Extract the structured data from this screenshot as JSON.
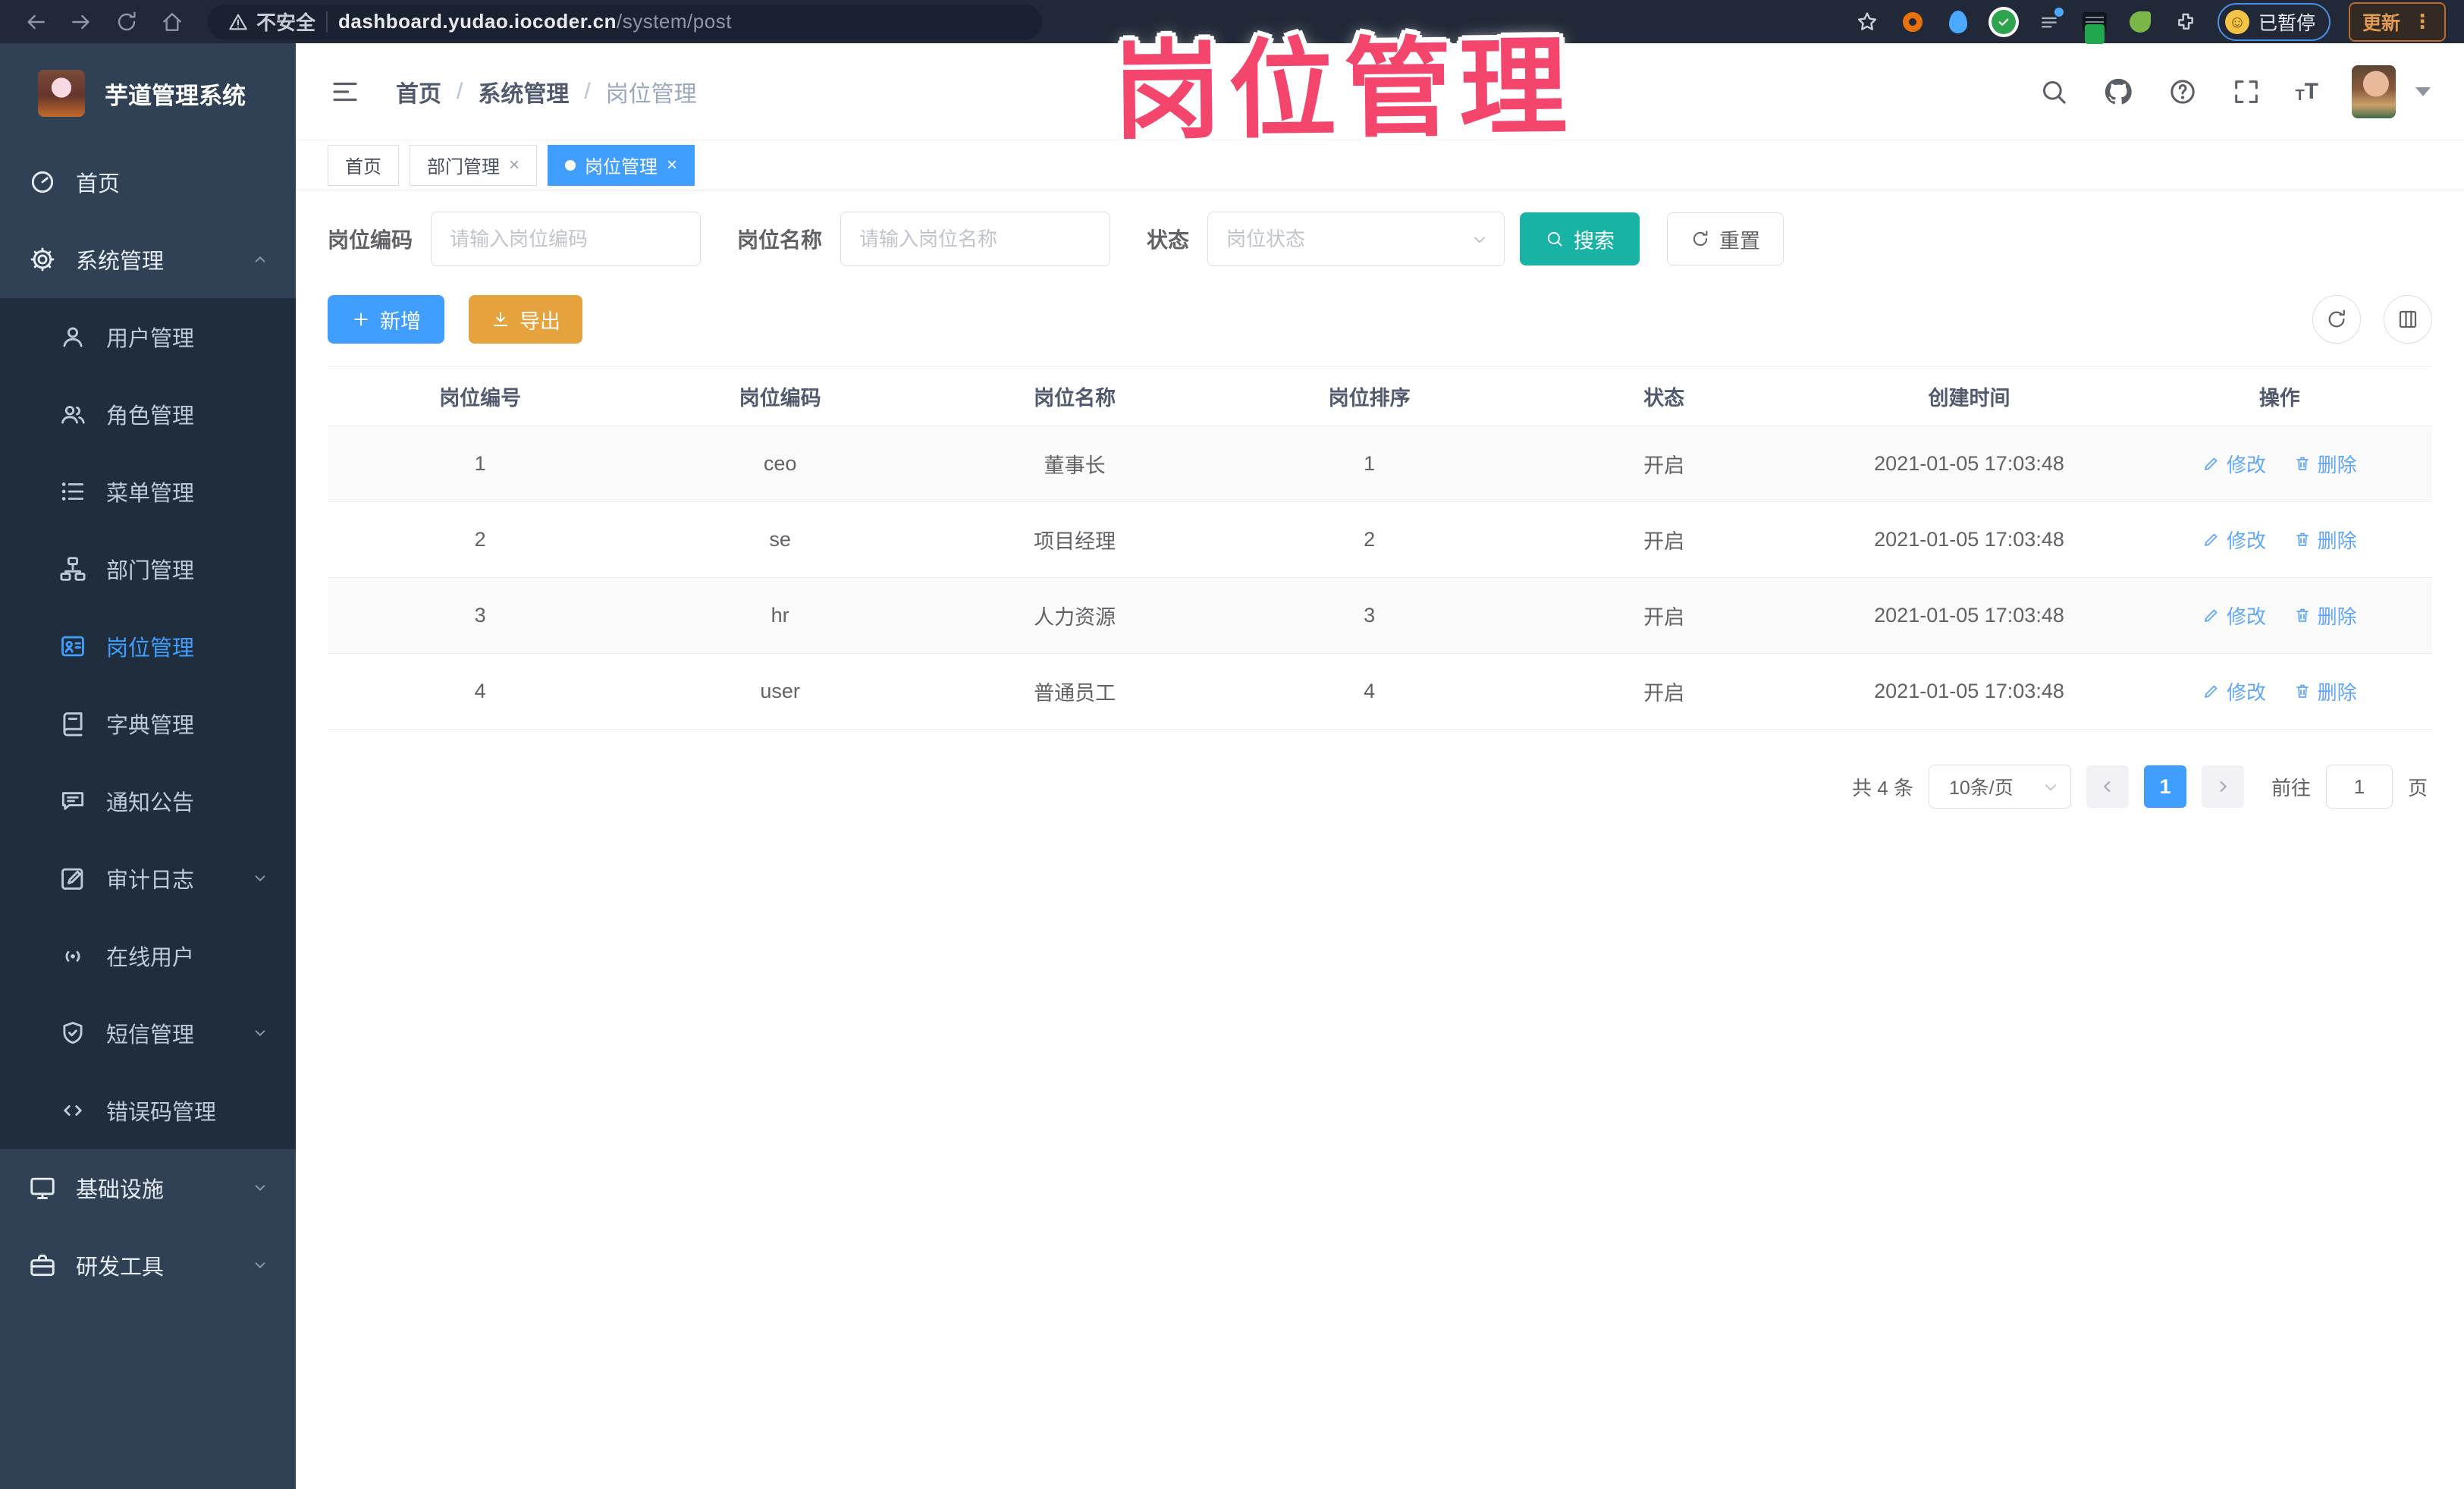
{
  "browser": {
    "security_label": "不安全",
    "url_host": "dashboard.yudao.iocoder.cn",
    "url_path": "/system/post",
    "paused_label": "已暂停",
    "update_label": "更新",
    "kebab_glyph": "⋮",
    "emoji_glyph": "☺"
  },
  "watermark": "岗位管理",
  "icons": {
    "close": "×",
    "font_large": "T",
    "font_small": "T"
  },
  "sidebar": {
    "app_title": "芋道管理系统",
    "items": [
      {
        "label": "首页"
      },
      {
        "label": "系统管理"
      },
      {
        "label": "用户管理"
      },
      {
        "label": "角色管理"
      },
      {
        "label": "菜单管理"
      },
      {
        "label": "部门管理"
      },
      {
        "label": "岗位管理"
      },
      {
        "label": "字典管理"
      },
      {
        "label": "通知公告"
      },
      {
        "label": "审计日志"
      },
      {
        "label": "在线用户"
      },
      {
        "label": "短信管理"
      },
      {
        "label": "错误码管理"
      },
      {
        "label": "基础设施"
      },
      {
        "label": "研发工具"
      }
    ]
  },
  "breadcrumb": {
    "home": "首页",
    "section": "系统管理",
    "current": "岗位管理",
    "separator": "/"
  },
  "tabs": [
    {
      "label": "首页"
    },
    {
      "label": "部门管理"
    },
    {
      "label": "岗位管理"
    }
  ],
  "filters": {
    "code_label": "岗位编码",
    "code_placeholder": "请输入岗位编码",
    "name_label": "岗位名称",
    "name_placeholder": "请输入岗位名称",
    "status_label": "状态",
    "status_placeholder": "岗位状态",
    "search_label": "搜索",
    "reset_label": "重置"
  },
  "toolbar": {
    "add_label": "新增",
    "export_label": "导出"
  },
  "table": {
    "headers": [
      "岗位编号",
      "岗位编码",
      "岗位名称",
      "岗位排序",
      "状态",
      "创建时间",
      "操作"
    ],
    "actions": {
      "edit": "修改",
      "delete": "删除"
    },
    "rows": [
      {
        "no": "1",
        "code": "ceo",
        "name": "董事长",
        "sort": "1",
        "status": "开启",
        "created": "2021-01-05 17:03:48"
      },
      {
        "no": "2",
        "code": "se",
        "name": "项目经理",
        "sort": "2",
        "status": "开启",
        "created": "2021-01-05 17:03:48"
      },
      {
        "no": "3",
        "code": "hr",
        "name": "人力资源",
        "sort": "3",
        "status": "开启",
        "created": "2021-01-05 17:03:48"
      },
      {
        "no": "4",
        "code": "user",
        "name": "普通员工",
        "sort": "4",
        "status": "开启",
        "created": "2021-01-05 17:03:48"
      }
    ]
  },
  "pagination": {
    "total_label": "共 4 条",
    "page_size": "10条/页",
    "current_page": "1",
    "goto_label": "前往",
    "goto_value": "1",
    "page_unit": "页"
  }
}
